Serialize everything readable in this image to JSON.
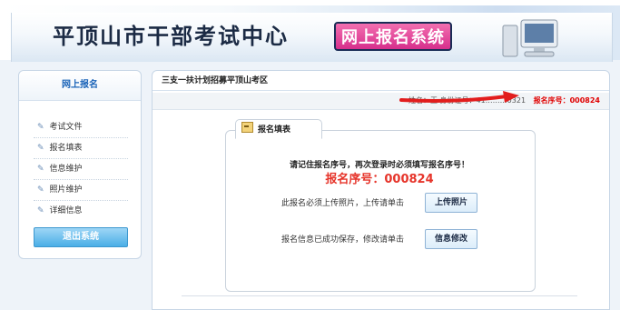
{
  "header": {
    "site_title": "平顶山市干部考试中心",
    "system_title": "网上报名系统"
  },
  "sidebar": {
    "title": "网上报名",
    "items": [
      {
        "label": "考试文件"
      },
      {
        "label": "报名填表"
      },
      {
        "label": "信息维护"
      },
      {
        "label": "照片维护"
      },
      {
        "label": "详细信息"
      }
    ],
    "logout_label": "退出系统"
  },
  "main": {
    "heading": "三支一扶计划招募平顶山考区",
    "info_bar": {
      "name_label": "姓名：",
      "name_value": "王",
      "id_label": "身份证号：",
      "id_value": "41………0321",
      "regno_label": "报名序号：",
      "regno_value": "000824"
    },
    "form": {
      "tab_title": "报名填表",
      "notice": "请记住报名序号，再次登录时必须填写报名序号！",
      "regnum_display": "报名序号：000824",
      "photo_text": "此报名必须上传照片，上传请单击",
      "photo_button": "上传照片",
      "edit_text": "报名信息已成功保存，修改请单击",
      "edit_button": "信息修改"
    }
  },
  "colors": {
    "accent_red": "#e00000",
    "link_blue": "#1a63b8",
    "button_blue": "#4aaee6"
  }
}
